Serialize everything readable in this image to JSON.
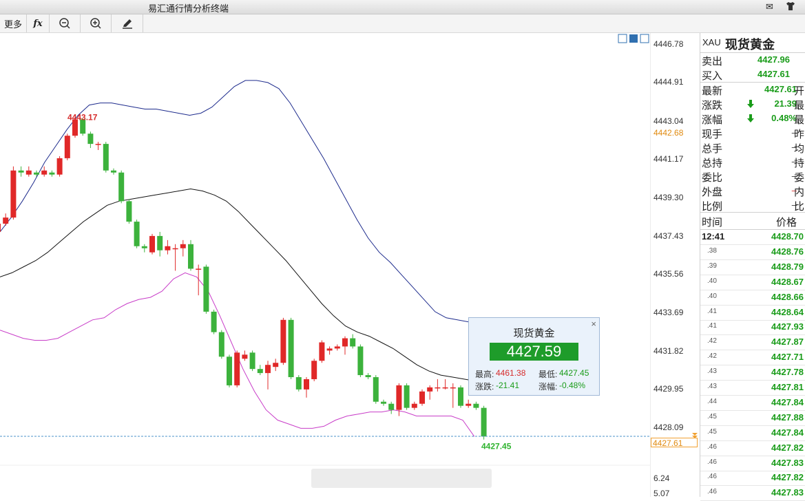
{
  "window": {
    "title": "易汇通行情分析终端"
  },
  "toolbar": {
    "more": "更多",
    "fx": "fx"
  },
  "chart_data": {
    "type": "candlestick",
    "ylim": [
      4427.0,
      4447.0
    ],
    "y_ticks": [
      "4446.78",
      "4444.91",
      "4443.04",
      "4441.17",
      "4439.30",
      "4437.43",
      "4435.56",
      "4433.69",
      "4431.82",
      "4429.95",
      "4428.09"
    ],
    "lower_ticks": [
      "6.24",
      "5.07"
    ],
    "cursor_price": "4442.68",
    "last_price_tag": "4427.61",
    "high_annotation": "4443.17",
    "low_annotation": "4427.45",
    "candles": [
      {
        "o": 4437.6,
        "c": 4438.0,
        "h": 4438.1,
        "l": 4437.4
      },
      {
        "o": 4438.0,
        "c": 4438.3,
        "h": 4438.5,
        "l": 4437.9
      },
      {
        "o": 4438.3,
        "c": 4440.6,
        "h": 4440.8,
        "l": 4438.2
      },
      {
        "o": 4440.6,
        "c": 4440.5,
        "h": 4440.8,
        "l": 4440.3
      },
      {
        "o": 4440.4,
        "c": 4440.6,
        "h": 4440.8,
        "l": 4440.3
      },
      {
        "o": 4440.5,
        "c": 4440.4,
        "h": 4440.6,
        "l": 4440.3
      },
      {
        "o": 4440.4,
        "c": 4440.6,
        "h": 4440.8,
        "l": 4440.3
      },
      {
        "o": 4440.5,
        "c": 4440.4,
        "h": 4440.6,
        "l": 4440.3
      },
      {
        "o": 4440.4,
        "c": 4441.2,
        "h": 4441.3,
        "l": 4440.3
      },
      {
        "o": 4441.2,
        "c": 4442.3,
        "h": 4442.4,
        "l": 4441.1
      },
      {
        "o": 4442.3,
        "c": 4443.1,
        "h": 4443.2,
        "l": 4442.2
      },
      {
        "o": 4443.1,
        "c": 4442.4,
        "h": 4443.17,
        "l": 4442.3
      },
      {
        "o": 4442.4,
        "c": 4441.9,
        "h": 4442.5,
        "l": 4441.7
      },
      {
        "o": 4441.9,
        "c": 4441.9,
        "h": 4442.0,
        "l": 4441.6
      },
      {
        "o": 4441.9,
        "c": 4440.6,
        "h": 4442.0,
        "l": 4440.5
      },
      {
        "o": 4440.6,
        "c": 4440.5,
        "h": 4440.7,
        "l": 4440.4
      },
      {
        "o": 4440.5,
        "c": 4439.1,
        "h": 4440.6,
        "l": 4439.0
      },
      {
        "o": 4439.1,
        "c": 4438.1,
        "h": 4439.2,
        "l": 4438.0
      },
      {
        "o": 4438.1,
        "c": 4436.9,
        "h": 4438.2,
        "l": 4436.8
      },
      {
        "o": 4436.9,
        "c": 4436.8,
        "h": 4437.0,
        "l": 4436.6
      },
      {
        "o": 4436.6,
        "c": 4437.4,
        "h": 4437.5,
        "l": 4436.5
      },
      {
        "o": 4437.4,
        "c": 4436.7,
        "h": 4437.6,
        "l": 4436.4
      },
      {
        "o": 4436.7,
        "c": 4436.9,
        "h": 4437.2,
        "l": 4436.5
      },
      {
        "o": 4436.8,
        "c": 4436.8,
        "h": 4437.0,
        "l": 4435.7
      },
      {
        "o": 4436.8,
        "c": 4437.0,
        "h": 4437.2,
        "l": 4436.4
      },
      {
        "o": 4437.0,
        "c": 4435.8,
        "h": 4437.2,
        "l": 4435.7
      },
      {
        "o": 4435.8,
        "c": 4435.8,
        "h": 4436.0,
        "l": 4434.5
      },
      {
        "o": 4435.9,
        "c": 4433.7,
        "h": 4436.0,
        "l": 4433.6
      },
      {
        "o": 4433.7,
        "c": 4432.7,
        "h": 4433.8,
        "l": 4432.6
      },
      {
        "o": 4432.7,
        "c": 4431.5,
        "h": 4432.8,
        "l": 4431.4
      },
      {
        "o": 4431.5,
        "c": 4430.1,
        "h": 4431.6,
        "l": 4430.0
      },
      {
        "o": 4430.1,
        "c": 4431.7,
        "h": 4431.8,
        "l": 4430.0
      },
      {
        "o": 4431.4,
        "c": 4431.6,
        "h": 4431.8,
        "l": 4431.3
      },
      {
        "o": 4431.7,
        "c": 4430.9,
        "h": 4431.8,
        "l": 4430.8
      },
      {
        "o": 4430.9,
        "c": 4430.7,
        "h": 4431.1,
        "l": 4430.6
      },
      {
        "o": 4430.7,
        "c": 4431.1,
        "h": 4431.3,
        "l": 4429.9
      },
      {
        "o": 4431.0,
        "c": 4431.2,
        "h": 4431.4,
        "l": 4430.8
      },
      {
        "o": 4431.2,
        "c": 4433.3,
        "h": 4433.4,
        "l": 4431.1
      },
      {
        "o": 4433.3,
        "c": 4430.5,
        "h": 4433.4,
        "l": 4430.4
      },
      {
        "o": 4430.5,
        "c": 4429.9,
        "h": 4430.6,
        "l": 4429.8
      },
      {
        "o": 4429.9,
        "c": 4430.4,
        "h": 4430.5,
        "l": 4429.5
      },
      {
        "o": 4430.4,
        "c": 4431.3,
        "h": 4431.4,
        "l": 4430.3
      },
      {
        "o": 4431.3,
        "c": 4432.2,
        "h": 4432.3,
        "l": 4431.2
      },
      {
        "o": 4431.8,
        "c": 4431.9,
        "h": 4432.0,
        "l": 4431.6
      },
      {
        "o": 4431.9,
        "c": 4432.0,
        "h": 4432.1,
        "l": 4431.8
      },
      {
        "o": 4432.0,
        "c": 4432.4,
        "h": 4432.5,
        "l": 4431.6
      },
      {
        "o": 4432.4,
        "c": 4432.0,
        "h": 4432.6,
        "l": 4431.9
      },
      {
        "o": 4432.0,
        "c": 4430.6,
        "h": 4432.1,
        "l": 4430.5
      },
      {
        "o": 4430.6,
        "c": 4430.5,
        "h": 4430.7,
        "l": 4430.4
      },
      {
        "o": 4430.5,
        "c": 4429.3,
        "h": 4430.6,
        "l": 4429.2
      },
      {
        "o": 4429.3,
        "c": 4429.2,
        "h": 4429.4,
        "l": 4429.1
      },
      {
        "o": 4429.2,
        "c": 4428.9,
        "h": 4429.3,
        "l": 4428.7
      },
      {
        "o": 4428.9,
        "c": 4430.1,
        "h": 4430.2,
        "l": 4428.6
      },
      {
        "o": 4430.1,
        "c": 4429.0,
        "h": 4430.2,
        "l": 4428.9
      },
      {
        "o": 4429.0,
        "c": 4429.2,
        "h": 4429.3,
        "l": 4428.9
      },
      {
        "o": 4429.2,
        "c": 4429.8,
        "h": 4429.9,
        "l": 4429.1
      },
      {
        "o": 4429.8,
        "c": 4430.0,
        "h": 4430.1,
        "l": 4429.4
      },
      {
        "o": 4430.0,
        "c": 4430.0,
        "h": 4430.4,
        "l": 4429.8
      },
      {
        "o": 4430.0,
        "c": 4430.0,
        "h": 4430.4,
        "l": 4429.9
      },
      {
        "o": 4430.0,
        "c": 4430.0,
        "h": 4430.2,
        "l": 4429.0
      },
      {
        "o": 4430.0,
        "c": 4429.1,
        "h": 4430.1,
        "l": 4429.0
      },
      {
        "o": 4429.1,
        "c": 4429.2,
        "h": 4429.4,
        "l": 4429.0
      },
      {
        "o": 4429.2,
        "c": 4429.0,
        "h": 4429.3,
        "l": 4428.9
      },
      {
        "o": 4429.0,
        "c": 4427.6,
        "h": 4429.1,
        "l": 4427.45
      }
    ],
    "upper_band": [
      4437.6,
      4438.3,
      4439.1,
      4440.0,
      4441.0,
      4441.8,
      4442.6,
      4443.3,
      4443.8,
      4443.9,
      4443.9,
      4443.8,
      4443.7,
      4443.6,
      4443.6,
      4443.5,
      4443.4,
      4443.3,
      4443.4,
      4443.7,
      4444.2,
      4444.7,
      4445.0,
      4445.0,
      4444.9,
      4444.6,
      4443.9,
      4443.0,
      4442.1,
      4441.2,
      4440.2,
      4439.2,
      4438.2,
      4437.3,
      4436.6,
      4436.1,
      4435.5,
      4434.9,
      4434.3,
      4433.7,
      4433.4,
      4433.3,
      4433.2,
      4433.2,
      4433.2
    ],
    "mid_band": [
      4435.4,
      4435.6,
      4435.9,
      4436.2,
      4436.6,
      4437.1,
      4437.6,
      4438.1,
      4438.5,
      4438.9,
      4439.1,
      4439.2,
      4439.3,
      4439.4,
      4439.5,
      4439.6,
      4439.7,
      4439.6,
      4439.4,
      4439.1,
      4438.6,
      4438.0,
      4437.4,
      4436.8,
      4436.2,
      4435.5,
      4434.8,
      4434.1,
      4433.5,
      4433.0,
      4432.7,
      4432.5,
      4432.2,
      4431.9,
      4431.5,
      4431.1,
      4430.8,
      4430.6,
      4430.5,
      4430.4,
      4430.3
    ],
    "lower_band": [
      4432.8,
      4432.6,
      4432.4,
      4432.3,
      4432.3,
      4432.4,
      4432.7,
      4433.0,
      4433.3,
      4433.4,
      4433.8,
      4434.1,
      4434.3,
      4434.4,
      4434.7,
      4435.3,
      4435.6,
      4435.4,
      4434.7,
      4433.5,
      4432.2,
      4430.9,
      4429.8,
      4428.9,
      4428.4,
      4428.2,
      4428.0,
      4428.0,
      4428.1,
      4428.4,
      4428.6,
      4428.7,
      4428.8,
      4428.8,
      4428.9,
      4428.8,
      4428.6,
      4428.6,
      4428.6,
      4428.6,
      4428.4,
      4427.6
    ]
  },
  "popup": {
    "title": "现货黄金",
    "price": "4427.59",
    "high_label": "最高:",
    "high": "4461.38",
    "low_label": "最低:",
    "low": "4427.45",
    "change_label": "涨跌:",
    "change": "-21.41",
    "pct_label": "涨幅:",
    "pct": "-0.48%",
    "close": "×"
  },
  "quote": {
    "symbol": "XAU",
    "name": "现货黄金",
    "sell_label": "卖出",
    "sell": "4427.96",
    "buy_label": "买入",
    "buy": "4427.61",
    "rows": [
      {
        "label": "最新",
        "value": "4427.61",
        "right": "开"
      },
      {
        "label": "涨跌",
        "value": "21.39",
        "right": "最"
      },
      {
        "label": "涨幅",
        "value": "0.48%",
        "right": "最"
      },
      {
        "label": "现手",
        "value": "–",
        "right": "昨"
      },
      {
        "label": "总手",
        "value": "–",
        "right": "均"
      },
      {
        "label": "总持",
        "value": "–",
        "right": "持"
      },
      {
        "label": "委比",
        "value": "–",
        "right": "委"
      },
      {
        "label": "外盘",
        "value": "–",
        "right": "内"
      },
      {
        "label": "比例",
        "value": "–",
        "right": "比"
      }
    ],
    "colors": {
      "green": "#1a9c1a",
      "red": "#d62b2b"
    }
  },
  "ticks": {
    "time_header": "时间",
    "price_header": "价格",
    "rows": [
      {
        "t": "12:41",
        "p": "4428.70"
      },
      {
        "t": ".38",
        "p": "4428.76"
      },
      {
        "t": ".39",
        "p": "4428.79"
      },
      {
        "t": ".40",
        "p": "4428.67"
      },
      {
        "t": ".40",
        "p": "4428.66"
      },
      {
        "t": ".41",
        "p": "4428.64"
      },
      {
        "t": ".41",
        "p": "4427.93"
      },
      {
        "t": ".42",
        "p": "4427.87"
      },
      {
        "t": ".42",
        "p": "4427.71"
      },
      {
        "t": ".43",
        "p": "4427.78"
      },
      {
        "t": ".43",
        "p": "4427.81"
      },
      {
        "t": ".44",
        "p": "4427.84"
      },
      {
        "t": ".45",
        "p": "4427.88"
      },
      {
        "t": ".45",
        "p": "4427.84"
      },
      {
        "t": ".46",
        "p": "4427.82"
      },
      {
        "t": ".46",
        "p": "4427.83"
      },
      {
        "t": ".46",
        "p": "4427.82"
      },
      {
        "t": ".46",
        "p": "4427.83"
      }
    ]
  }
}
